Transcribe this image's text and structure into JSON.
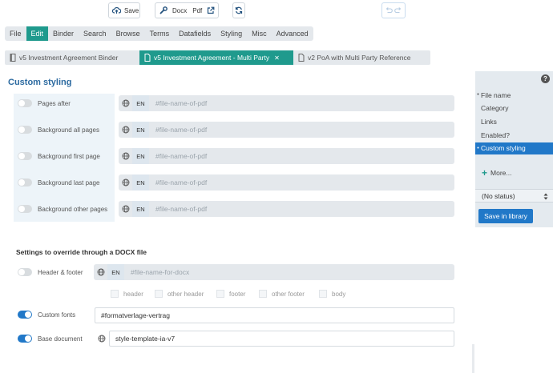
{
  "toolbar": {
    "save_label": "Save",
    "docx_label": "Docx",
    "pdf_label": "Pdf"
  },
  "menu": {
    "items": [
      "File",
      "Edit",
      "Binder",
      "Search",
      "Browse",
      "Terms",
      "Datafields",
      "Styling",
      "Misc",
      "Advanced"
    ],
    "active": "Edit"
  },
  "doc_tabs": [
    {
      "label": "v5 Investment Agreement Binder",
      "active": false
    },
    {
      "label": "v5 Investment Agreement - Multi Party",
      "active": true,
      "close": "✕"
    },
    {
      "label": "v2 PoA with Multi Party Reference",
      "active": false
    }
  ],
  "custom_styling": {
    "title": "Custom styling",
    "rows": [
      {
        "label": "Pages after",
        "lang": "EN",
        "placeholder": "#file-name-of-pdf",
        "enabled": false
      },
      {
        "label": "Background all pages",
        "lang": "EN",
        "placeholder": "#file-name-of-pdf",
        "enabled": false
      },
      {
        "label": "Background first page",
        "lang": "EN",
        "placeholder": "#file-name-of-pdf",
        "enabled": false
      },
      {
        "label": "Background last page",
        "lang": "EN",
        "placeholder": "#file-name-of-pdf",
        "enabled": false
      },
      {
        "label": "Background other pages",
        "lang": "EN",
        "placeholder": "#file-name-of-pdf",
        "enabled": false
      }
    ]
  },
  "docx_settings": {
    "title": "Settings to override through a DOCX file",
    "header_footer": {
      "label": "Header & footer",
      "lang": "EN",
      "placeholder": "#file-name-for-docx",
      "enabled": false
    },
    "checkboxes": [
      "header",
      "other header",
      "footer",
      "other footer",
      "body"
    ],
    "custom_fonts": {
      "label": "Custom fonts",
      "value": "#formatverlage-vertrag",
      "enabled": true
    },
    "base_document": {
      "label": "Base document",
      "value": "style-template-ia-v7",
      "enabled": true
    }
  },
  "sidebar": {
    "help": "?",
    "items": [
      {
        "label": "File name",
        "bullet": "•",
        "active": false
      },
      {
        "label": "Category",
        "bullet": "",
        "active": false
      },
      {
        "label": "Links",
        "bullet": "",
        "active": false
      },
      {
        "label": "Enabled?",
        "bullet": "",
        "active": false
      },
      {
        "label": "Custom styling",
        "bullet": "•",
        "active": true
      }
    ],
    "more_label": "More...",
    "status_value": "(No status)",
    "save_library_label": "Save in library"
  },
  "colors": {
    "accent_teal": "#1f9a8d",
    "accent_blue": "#2178c8",
    "title_blue": "#2c6aa0"
  }
}
